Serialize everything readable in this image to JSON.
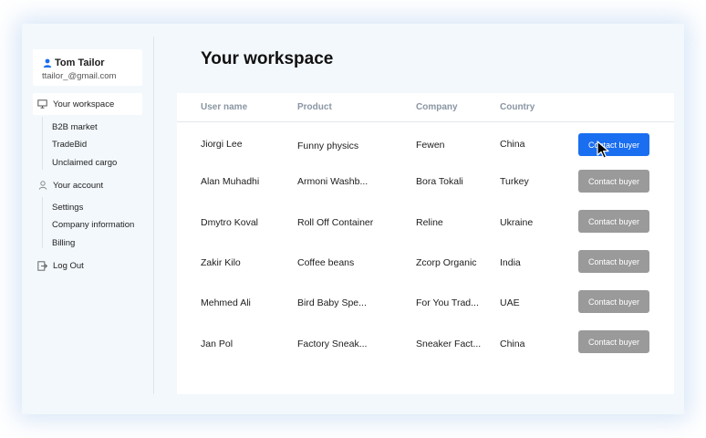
{
  "user": {
    "name": "Tom Tailor",
    "email": "ttailor_@gmail.com"
  },
  "sidebar": {
    "workspace_label": "Your workspace",
    "workspace_items": [
      {
        "label": "B2B market",
        "selected": true
      },
      {
        "label": "TradeBid",
        "selected": false
      },
      {
        "label": "Unclaimed cargo",
        "selected": false
      }
    ],
    "account_label": "Your account",
    "account_items": [
      {
        "label": "Settings"
      },
      {
        "label": "Company information"
      },
      {
        "label": "Billing"
      }
    ],
    "logout_label": "Log Out"
  },
  "main": {
    "title": "Your workspace",
    "table": {
      "columns": [
        "User name",
        "Product",
        "Company",
        "Country"
      ],
      "rows": [
        {
          "user": "Jiorgi Lee",
          "product": "Funny physics",
          "company": "Fewen",
          "country": "China",
          "action": "Contact buyer",
          "active": true
        },
        {
          "user": "Alan Muhadhi",
          "product": "Armoni Washb...",
          "company": "Bora Tokali",
          "country": "Turkey",
          "action": "Contact buyer",
          "active": false
        },
        {
          "user": "Dmytro Koval",
          "product": "Roll Off Container",
          "company": "Reline",
          "country": "Ukraine",
          "action": "Contact buyer",
          "active": false
        },
        {
          "user": "Zakir Kilo",
          "product": "Coffee beans",
          "company": "Zcorp Organic",
          "country": "India",
          "action": "Contact buyer",
          "active": false
        },
        {
          "user": "Mehmed Ali",
          "product": "Bird Baby Spe...",
          "company": "For You Trad...",
          "country": "UAE",
          "action": "Contact buyer",
          "active": false
        },
        {
          "user": "Jan Pol",
          "product": "Factory Sneak...",
          "company": "Sneaker Fact...",
          "country": "China",
          "action": "Contact buyer",
          "active": false
        }
      ]
    }
  },
  "colors": {
    "accent": "#1a6ef0",
    "selected_nav": "#1469e6",
    "button_inactive": "#9a9a9a",
    "window_bg": "#f3f8fc"
  },
  "icons": {
    "user": "person-icon",
    "workspace": "monitor-icon",
    "account": "person-outline-icon",
    "logout": "logout-icon",
    "cursor": "mouse-cursor-icon"
  }
}
